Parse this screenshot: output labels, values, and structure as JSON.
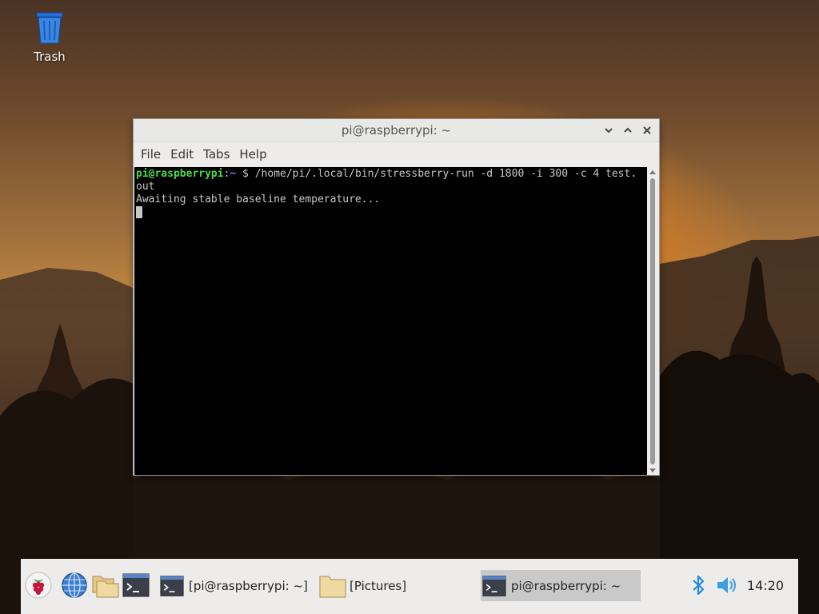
{
  "desktop": {
    "trash_label": "Trash"
  },
  "window": {
    "title": "pi@raspberrypi: ~",
    "menu": [
      "File",
      "Edit",
      "Tabs",
      "Help"
    ]
  },
  "terminal": {
    "prompt_user": "pi@raspberrypi",
    "prompt_sep": ":",
    "prompt_path": "~",
    "prompt_symbol": " $ ",
    "command": "/home/pi/.local/bin/stressberry-run -d 1800 -i 300 -c 4 test.",
    "command_wrap": "out",
    "output": "Awaiting stable baseline temperature..."
  },
  "taskbar": {
    "tasks": [
      {
        "label": "[pi@raspberrypi: ~]",
        "icon": "terminal-icon"
      },
      {
        "label": "[Pictures]",
        "icon": "folder-icon"
      },
      {
        "label": "pi@raspberrypi: ~",
        "icon": "terminal-icon"
      }
    ],
    "clock": "14:20"
  },
  "colors": {
    "prompt_user": "#4fd84f",
    "prompt_path": "#6b7bff",
    "terminal_bg": "#000000",
    "bluetooth": "#1e88e5",
    "volume": "#3aa0e0"
  },
  "icons": [
    "trash-icon",
    "raspberry-menu-icon",
    "web-browser-icon",
    "file-manager-icon",
    "terminal-icon",
    "bluetooth-icon",
    "volume-icon"
  ]
}
